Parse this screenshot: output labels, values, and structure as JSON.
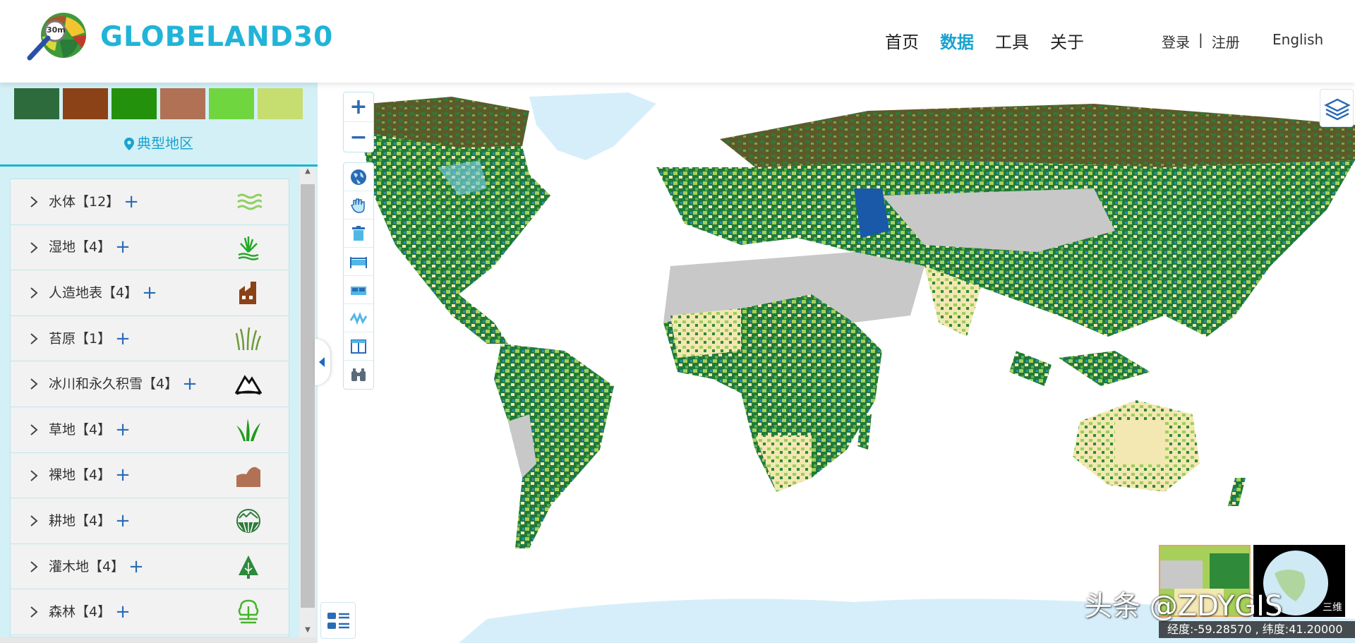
{
  "header": {
    "logo_text": "GLOBELAND30",
    "logo_badge": "30m",
    "nav": [
      {
        "label": "首页",
        "active": false
      },
      {
        "label": "数据",
        "active": true
      },
      {
        "label": "工具",
        "active": false
      },
      {
        "label": "关于",
        "active": false
      }
    ],
    "login": "登录",
    "auth_separator": "|",
    "register": "注册",
    "language": "English"
  },
  "sidebar": {
    "swatch_colors": [
      "#2d6b3c",
      "#8b4216",
      "#24910c",
      "#b07155",
      "#70d640",
      "#c6dd70"
    ],
    "region_label": "典型地区",
    "items": [
      {
        "label": "水体【12】",
        "plus": "+",
        "icon": "water-icon"
      },
      {
        "label": "湿地【4】",
        "plus": "+",
        "icon": "wetland-icon"
      },
      {
        "label": "人造地表【4】",
        "plus": "+",
        "icon": "artificial-surface-icon"
      },
      {
        "label": "苔原【1】",
        "plus": "+",
        "icon": "tundra-icon"
      },
      {
        "label": "冰川和永久积雪【4】",
        "plus": "+",
        "icon": "glacier-icon"
      },
      {
        "label": "草地【4】",
        "plus": "+",
        "icon": "grassland-icon"
      },
      {
        "label": "裸地【4】",
        "plus": "+",
        "icon": "bare-land-icon"
      },
      {
        "label": "耕地【4】",
        "plus": "+",
        "icon": "cultivated-land-icon"
      },
      {
        "label": "灌木地【4】",
        "plus": "+",
        "icon": "shrubland-icon"
      },
      {
        "label": "森林【4】",
        "plus": "+",
        "icon": "forest-icon"
      }
    ]
  },
  "map": {
    "zoom_in": "+",
    "zoom_out": "−",
    "tools": [
      "globe-icon",
      "hand-pan-icon",
      "trash-icon",
      "measure-distance-icon",
      "measure-area-icon",
      "profile-icon",
      "split-view-icon",
      "binoculars-icon"
    ],
    "mini_3d_label": "三维",
    "coordinates": "经度:-59.28570 , 纬度:41.20000",
    "watermark": "头条 @ZDYGIS"
  }
}
